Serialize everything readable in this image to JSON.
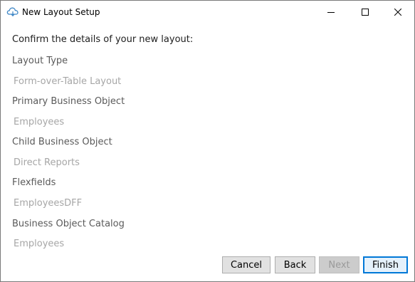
{
  "window": {
    "title": "New Layout Setup",
    "icon": "cloud-icon"
  },
  "controls": {
    "minimize": "minimize-icon",
    "maximize": "maximize-icon",
    "close": "close-icon"
  },
  "heading": "Confirm the details of your new layout:",
  "fields": [
    {
      "label": "Layout Type",
      "value": "Form-over-Table Layout"
    },
    {
      "label": "Primary Business Object",
      "value": "Employees"
    },
    {
      "label": "Child Business Object",
      "value": "Direct Reports"
    },
    {
      "label": "Flexfields",
      "value": "EmployeesDFF"
    },
    {
      "label": "Business Object Catalog",
      "value": "Employees"
    }
  ],
  "buttons": {
    "cancel": "Cancel",
    "back": "Back",
    "next": "Next",
    "finish": "Finish"
  },
  "colors": {
    "label": "#5a5a5a",
    "value": "#a6a6a6",
    "focus_border": "#0078d7"
  }
}
